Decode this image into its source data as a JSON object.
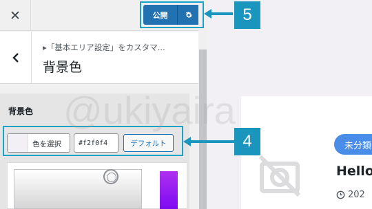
{
  "header": {
    "close_glyph": "✕",
    "publish_label": "公開"
  },
  "section": {
    "breadcrumb": "▸「基本エリア設定」をカスタマ...",
    "title": "背景色"
  },
  "control": {
    "label": "背景色",
    "select_color_label": "色を選択",
    "hex_value": "#f2f0f4",
    "default_label": "デフォルト",
    "current_color": "#f2f0f4"
  },
  "preview": {
    "category_badge": "未分類",
    "post_title": "Hello",
    "post_date": "202"
  },
  "annotations": {
    "badge_5": "5",
    "badge_4": "4"
  },
  "watermark": "@ukiyaira",
  "colors": {
    "accent": "#2271b1",
    "annotation": "#1a95be",
    "badge_blue": "#4a8de8",
    "preview_bg": "#f2f0f4"
  }
}
